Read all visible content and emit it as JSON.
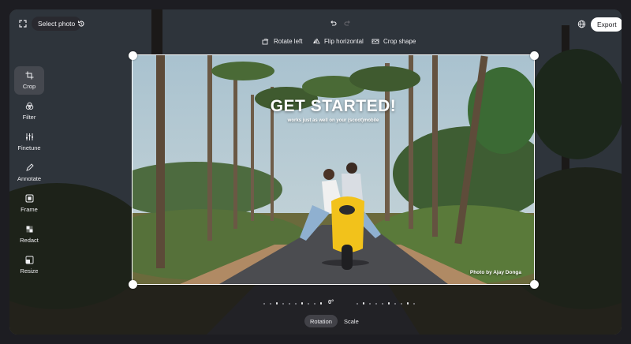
{
  "topbar": {
    "select_photo": "Select photo",
    "export": "Export"
  },
  "tools": [
    {
      "label": "Rotate left",
      "icon": "rotate-left-icon"
    },
    {
      "label": "Flip horizontal",
      "icon": "flip-horizontal-icon"
    },
    {
      "label": "Crop shape",
      "icon": "crop-shape-icon"
    }
  ],
  "sidebar": {
    "items": [
      {
        "label": "Crop",
        "icon": "crop-icon",
        "active": true
      },
      {
        "label": "Filter",
        "icon": "filter-icon"
      },
      {
        "label": "Finetune",
        "icon": "finetune-icon"
      },
      {
        "label": "Annotate",
        "icon": "annotate-icon"
      },
      {
        "label": "Frame",
        "icon": "frame-icon"
      },
      {
        "label": "Redact",
        "icon": "redact-icon"
      },
      {
        "label": "Resize",
        "icon": "resize-icon"
      }
    ]
  },
  "image": {
    "headline": "GET STARTED!",
    "subline": "works just as well on your (scoot)mobile",
    "credit": "Photo by Ajay Donga"
  },
  "rotation": {
    "degrees": "0°"
  },
  "bottom_tabs": {
    "rotation": "Rotation",
    "scale": "Scale"
  },
  "colors": {
    "background": "#1d1d22",
    "accent_white": "#ffffff",
    "scooter_yellow": "#f2c21b"
  }
}
